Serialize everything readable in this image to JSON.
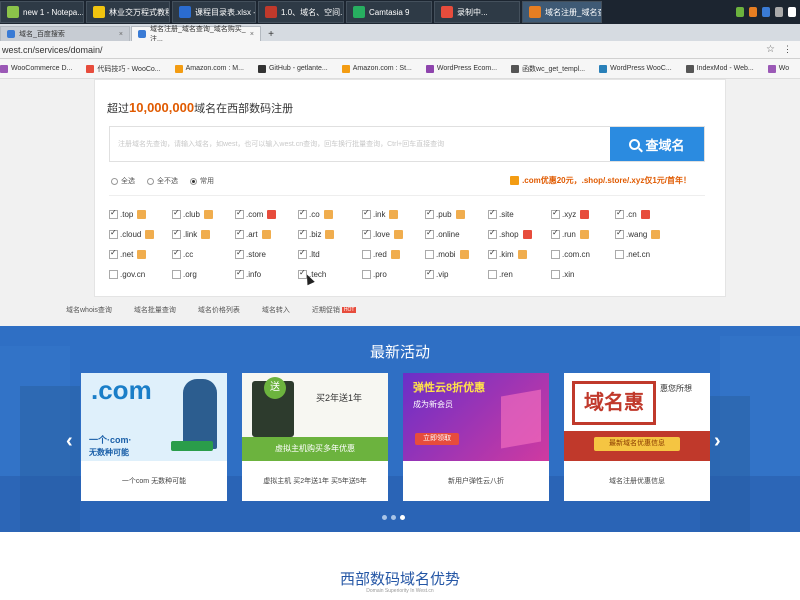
{
  "taskbar": {
    "items": [
      {
        "label": "new 1 - Notepa...",
        "color": "#8bc34a"
      },
      {
        "label": "林业交万程式教程",
        "color": "#f1c40f"
      },
      {
        "label": "课程目录表.xlsx - ...",
        "color": "#2b6cd0"
      },
      {
        "label": "1.0、域名、空间...",
        "color": "#c0392b"
      },
      {
        "label": "Camtasia 9",
        "color": "#27ae60"
      },
      {
        "label": "录制中...",
        "color": "#e74c3c"
      },
      {
        "label": "域名注册_域名查...",
        "color": "#e67e22"
      }
    ]
  },
  "tabs": [
    {
      "label": "域名_百度搜索"
    },
    {
      "label": "域名注册_域名查询_域名购买_注..."
    }
  ],
  "address": {
    "url": "west.cn/services/domain/"
  },
  "bookmarks": [
    {
      "label": "WooCommerce D...",
      "color": "#9b59b6"
    },
    {
      "label": "代码技巧 - WooCo...",
      "color": "#e74c3c"
    },
    {
      "label": "Amazon.com : M...",
      "color": "#f39c12"
    },
    {
      "label": "GitHub - getlante...",
      "color": "#333333"
    },
    {
      "label": "Amazon.com : St...",
      "color": "#f39c12"
    },
    {
      "label": "WordPress Ecom...",
      "color": "#8e44ad"
    },
    {
      "label": "函数wc_get_templ...",
      "color": "#555555"
    },
    {
      "label": "WordPress WooC...",
      "color": "#2980b9"
    },
    {
      "label": "IndexMod - Web...",
      "color": "#555555"
    },
    {
      "label": "Wo",
      "color": "#9b59b6"
    }
  ],
  "search": {
    "headline_prefix": "超过",
    "headline_number": "10,000,000",
    "headline_suffix": "域名在西部数码注册",
    "placeholder": "注册域名先查询，请输入域名，如west，也可以输入west.cn查询，回车换行批量查询，Ctrl+回车直接查询",
    "button": "查域名",
    "options": [
      {
        "label": "全选",
        "checked": false
      },
      {
        "label": "全不选",
        "checked": false
      },
      {
        "label": "常用",
        "checked": true
      }
    ],
    "promo": ".com优惠20元，.shop/.store/.xyz仅1元/首年！"
  },
  "tlds": [
    {
      "name": ".top",
      "checked": true,
      "badge": "#f0ad4e"
    },
    {
      "name": ".club",
      "checked": true,
      "badge": "#f0ad4e"
    },
    {
      "name": ".com",
      "checked": true,
      "badge": "#e74c3c"
    },
    {
      "name": ".co",
      "checked": true,
      "badge": "#f0ad4e"
    },
    {
      "name": ".ink",
      "checked": true,
      "badge": "#f0ad4e"
    },
    {
      "name": ".pub",
      "checked": true,
      "badge": "#f0ad4e"
    },
    {
      "name": ".site",
      "checked": true,
      "badge": ""
    },
    {
      "name": ".xyz",
      "checked": true,
      "badge": "#e74c3c"
    },
    {
      "name": ".cn",
      "checked": true,
      "badge": "#e74c3c"
    },
    {
      "name": ".cloud",
      "checked": true,
      "badge": "#f0ad4e"
    },
    {
      "name": ".link",
      "checked": true,
      "badge": "#f0ad4e"
    },
    {
      "name": ".art",
      "checked": true,
      "badge": "#f0ad4e"
    },
    {
      "name": ".biz",
      "checked": true,
      "badge": "#f0ad4e"
    },
    {
      "name": ".love",
      "checked": true,
      "badge": "#f0ad4e"
    },
    {
      "name": ".online",
      "checked": true,
      "badge": ""
    },
    {
      "name": ".shop",
      "checked": true,
      "badge": "#e74c3c"
    },
    {
      "name": ".run",
      "checked": true,
      "badge": "#f0ad4e"
    },
    {
      "name": ".wang",
      "checked": true,
      "badge": "#f0ad4e"
    },
    {
      "name": ".net",
      "checked": true,
      "badge": "#f0ad4e"
    },
    {
      "name": ".cc",
      "checked": true,
      "badge": ""
    },
    {
      "name": ".store",
      "checked": true,
      "badge": ""
    },
    {
      "name": ".ltd",
      "checked": true,
      "badge": ""
    },
    {
      "name": ".red",
      "checked": false,
      "badge": "#f0ad4e"
    },
    {
      "name": ".mobi",
      "checked": false,
      "badge": "#f0ad4e"
    },
    {
      "name": ".kim",
      "checked": true,
      "badge": "#f0ad4e"
    },
    {
      "name": ".com.cn",
      "checked": false,
      "badge": ""
    },
    {
      "name": ".net.cn",
      "checked": false,
      "badge": ""
    },
    {
      "name": ".gov.cn",
      "checked": false,
      "badge": ""
    },
    {
      "name": ".org",
      "checked": false,
      "badge": ""
    },
    {
      "name": ".info",
      "checked": true,
      "badge": ""
    },
    {
      "name": ".tech",
      "checked": true,
      "badge": ""
    },
    {
      "name": ".pro",
      "checked": false,
      "badge": ""
    },
    {
      "name": ".vip",
      "checked": true,
      "badge": ""
    },
    {
      "name": ".ren",
      "checked": false,
      "badge": ""
    },
    {
      "name": ".xin",
      "checked": false,
      "badge": ""
    }
  ],
  "subnav": [
    {
      "label": "域名whois查询"
    },
    {
      "label": "域名批量查询"
    },
    {
      "label": "域名价格列表"
    },
    {
      "label": "域名转入"
    },
    {
      "label": "近期促销",
      "hot": "HOT"
    }
  ],
  "activity": {
    "title": "最新活动",
    "slides": [
      {
        "caption": "一个com 无数种可能",
        "img_text": ".com",
        "sub_text": "一个·com·",
        "sub2": "无数种可能"
      },
      {
        "caption": "虚拟主机 买2年送1年 买5年送5年",
        "img_text": "送",
        "sub_text": "买2年送1年",
        "sub2": "虚拟主机购买多年优惠"
      },
      {
        "caption": "新用户弹性云八折",
        "img_text": "弹性云8折优惠",
        "sub_text": "成为新会员",
        "sub2": "立即领取"
      },
      {
        "caption": "域名注册优惠信息",
        "img_text": "域名惠",
        "sub_text": "惠您所想",
        "sub2": "最新域名优惠信息"
      }
    ]
  },
  "advantage": {
    "title": "西部数码域名优势",
    "subtitle": "Domain Superiority In West.cn"
  }
}
